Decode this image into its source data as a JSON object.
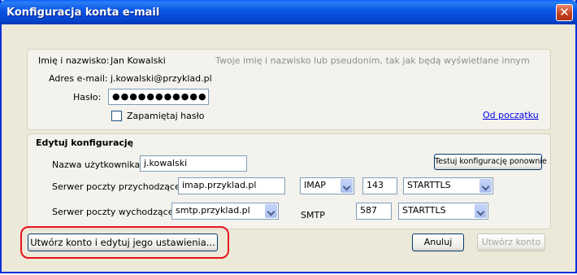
{
  "window": {
    "title": "Konfiguracja konta e-mail",
    "close_glyph": "✕"
  },
  "identity": {
    "name_label": "Imię i nazwisko:",
    "name_value": "Jan Kowalski",
    "name_hint": "Twoje imię i nazwisko lub pseudonim, tak jak będą wyświetlane innym",
    "email_label": "Adres e-mail:",
    "email_value": "j.kowalski@przyklad.pl",
    "password_label": "Hasło:",
    "password_value": "●●●●●●●●●●●",
    "remember_label": "Zapamiętaj hasło",
    "remember_checked": false,
    "start_over_link": "Od początku"
  },
  "config": {
    "section_title": "Edytuj konfigurację",
    "username_label": "Nazwa użytkownika:",
    "username_value": "j.kowalski",
    "retest_button": "Testuj konfigurację ponownie",
    "incoming_label": "Serwer poczty przychodzącej:",
    "incoming_server": "imap.przyklad.pl",
    "incoming_protocol": "IMAP",
    "incoming_port": "143",
    "incoming_security": "STARTTLS",
    "outgoing_label": "Serwer poczty wychodzącej:",
    "outgoing_server": "smtp.przyklad.pl",
    "outgoing_protocol": "SMTP",
    "outgoing_port": "587",
    "outgoing_security": "STARTTLS"
  },
  "footer": {
    "create_edit_button": "Utwórz konto i edytuj jego ustawienia...",
    "cancel_button": "Anuluj",
    "create_button": "Utwórz konto"
  },
  "colors": {
    "highlight": "#e8131b",
    "titlebar": "#0a57e8"
  }
}
